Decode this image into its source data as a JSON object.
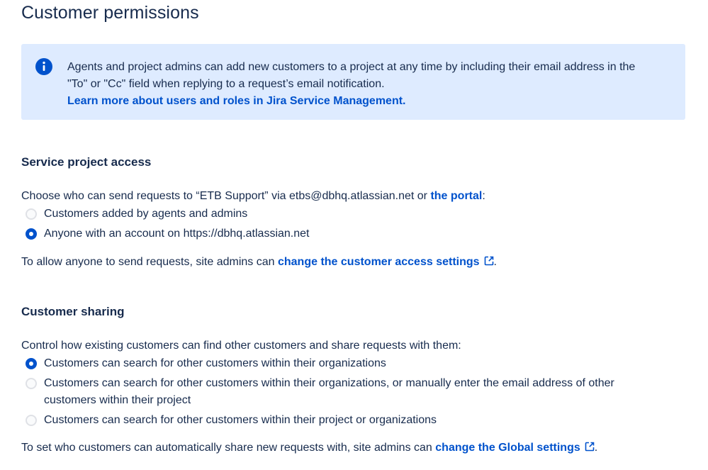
{
  "page": {
    "title": "Customer permissions"
  },
  "info_panel": {
    "icon": "info-icon",
    "line1": "Agents and project admins can add new customers to a project at any time by including their email address in the",
    "line2": "\"To\" or \"Cc\" field when replying to a request’s email notification.",
    "link": "Learn more about users and roles in Jira Service Management.",
    "color": "#deebff"
  },
  "service_access": {
    "heading": "Service project access",
    "intro_prefix": "Choose who can send requests to “ETB Support” via etbs@dbhq.atlassian.net or ",
    "intro_link": "the portal",
    "intro_suffix": ":",
    "options": [
      {
        "label": "Customers added by agents and admins",
        "selected": false
      },
      {
        "label": "Anyone with an account on https://dbhq.atlassian.net",
        "selected": true
      }
    ],
    "note_prefix": "To allow anyone to send requests, site admins can ",
    "note_link": "change the customer access settings",
    "note_link_icon": "external-link-icon",
    "note_suffix": "."
  },
  "customer_sharing": {
    "heading": "Customer sharing",
    "intro": "Control how existing customers can find other customers and share requests with them:",
    "options": [
      {
        "label": "Customers can search for other customers within their organizations",
        "selected": true
      },
      {
        "label_line1": "Customers can search for other customers within their organizations, or manually enter the email address of other",
        "label_line2": "customers within their project",
        "selected": false
      },
      {
        "label": "Customers can search for other customers within their project or organizations",
        "selected": false
      }
    ],
    "note_prefix": "To set who customers can automatically share new requests with, site admins can ",
    "note_link": "change the Global settings",
    "note_link_icon": "external-link-icon",
    "note_suffix": "."
  },
  "colors": {
    "text": "#172b4d",
    "link": "#0052cc",
    "radio_selected": "#0052cc",
    "radio_unselected_border": "#dfe1e6"
  }
}
